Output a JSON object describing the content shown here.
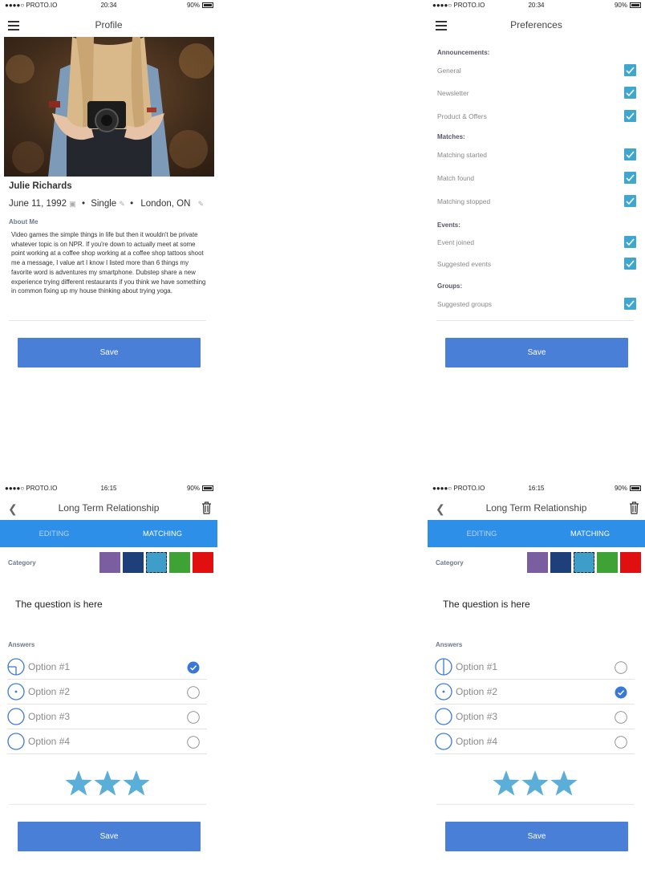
{
  "status": {
    "carrier": "●●●●○ PROTO.IO",
    "time_a": "20:34",
    "time_b": "16:15",
    "battery": "90%"
  },
  "profile": {
    "title": "Profile",
    "name": "Julie Richards",
    "birthday": "June 11, 1992",
    "status": "Single",
    "location": "London, ON",
    "about_heading": "About Me",
    "about_text": "Video games the simple things in life but then it wouldn't be private whatever topic is on NPR. If you're down to actually meet at some point working at a coffee shop working at a coffee shop tattoos shoot me a message, I value art I know I listed more than 6 things my favorite word is adventures my smartphone. Dubstep share a new experience trying different restaurants if you think we have something in common fixing up my house thinking about trying yoga.",
    "save_label": "Save"
  },
  "preferences": {
    "title": "Preferences",
    "announcements": "Announcements:",
    "general": "General",
    "newsletter": "Newsletter",
    "product_offers": "Product & Offers",
    "matches": "Matches:",
    "matching_started": "Matching started",
    "match_found": "Match found",
    "matching_stopped": "Matching stopped",
    "events": "Events:",
    "event_joined": "Event joined",
    "suggested_events": "Suggested events",
    "groups": "Groups:",
    "suggested_groups": "Suggested groups",
    "checked": [
      true,
      true,
      true,
      true,
      true,
      true,
      true,
      true,
      true
    ],
    "save_label": "Save"
  },
  "relationship": {
    "title": "Long Term Relationship",
    "tab_editing": "EDITING",
    "tab_matching": "MATCHING",
    "category_label": "Category",
    "category_colors": [
      "#7a5ea0",
      "#1f3f7a",
      "#3f9ec9",
      "#3ea234",
      "#e01010"
    ],
    "selected_category": 2,
    "question": "The question is here",
    "answers_label": "Answers",
    "options": [
      "Option #1",
      "Option #2",
      "Option #3",
      "Option #4"
    ],
    "selected_option_a": 0,
    "selected_option_b": 1,
    "star_color": "#5aaed8",
    "stars": 3,
    "save_label": "Save"
  }
}
